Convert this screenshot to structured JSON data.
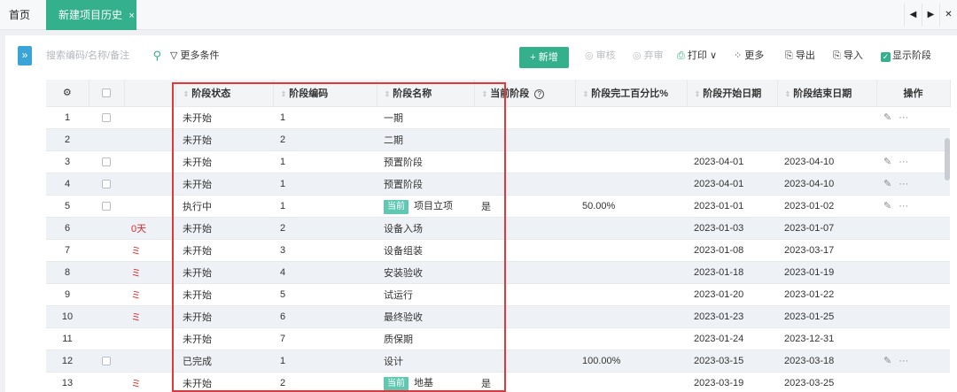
{
  "tabs": {
    "home": "首页",
    "active": "新建项目历史",
    "close": "×"
  },
  "nav": {
    "prev": "◀",
    "next": "▶",
    "close": "✕"
  },
  "toolbar": {
    "search_placeholder": "搜索编码/名称/备注",
    "more_conditions": "更多条件",
    "new": "+ 新增",
    "review": "审核",
    "abandon": "弃审",
    "print": "打印",
    "more": "更多",
    "export": "导出",
    "import": "导入",
    "show_stage": "显示阶段"
  },
  "table": {
    "headers": {
      "status": "阶段状态",
      "code": "阶段编码",
      "name": "阶段名称",
      "current": "当前阶段",
      "percent": "阶段完工百分比%",
      "start": "阶段开始日期",
      "end": "阶段结束日期",
      "ops": "操作"
    },
    "current_tag": "当前",
    "rows": [
      {
        "idx": "1",
        "chk": true,
        "flag": "",
        "status": "未开始",
        "code": "1",
        "tag": false,
        "name": "一期",
        "current": "",
        "percent": "",
        "start": "",
        "end": "",
        "ops": true
      },
      {
        "idx": "2",
        "chk": false,
        "flag": "",
        "status": "未开始",
        "code": "2",
        "tag": false,
        "name": "二期",
        "current": "",
        "percent": "",
        "start": "",
        "end": "",
        "ops": false
      },
      {
        "idx": "3",
        "chk": true,
        "flag": "",
        "status": "未开始",
        "code": "1",
        "tag": false,
        "name": "预置阶段",
        "current": "",
        "percent": "",
        "start": "2023-04-01",
        "end": "2023-04-10",
        "ops": true
      },
      {
        "idx": "4",
        "chk": true,
        "flag": "",
        "status": "未开始",
        "code": "1",
        "tag": false,
        "name": "预置阶段",
        "current": "",
        "percent": "",
        "start": "2023-04-01",
        "end": "2023-04-10",
        "ops": true
      },
      {
        "idx": "5",
        "chk": true,
        "flag": "",
        "status": "执行中",
        "code": "1",
        "tag": true,
        "name": "项目立项",
        "current": "是",
        "percent": "50.00%",
        "start": "2023-01-01",
        "end": "2023-01-02",
        "ops": true
      },
      {
        "idx": "6",
        "chk": false,
        "flag": "0天",
        "status": "未开始",
        "code": "2",
        "tag": false,
        "name": "设备入场",
        "current": "",
        "percent": "",
        "start": "2023-01-03",
        "end": "2023-01-07",
        "ops": false
      },
      {
        "idx": "7",
        "chk": false,
        "flag": "ミ",
        "status": "未开始",
        "code": "3",
        "tag": false,
        "name": "设备组装",
        "current": "",
        "percent": "",
        "start": "2023-01-08",
        "end": "2023-03-17",
        "ops": false
      },
      {
        "idx": "8",
        "chk": false,
        "flag": "ミ",
        "status": "未开始",
        "code": "4",
        "tag": false,
        "name": "安装验收",
        "current": "",
        "percent": "",
        "start": "2023-01-18",
        "end": "2023-01-19",
        "ops": false
      },
      {
        "idx": "9",
        "chk": false,
        "flag": "ミ",
        "status": "未开始",
        "code": "5",
        "tag": false,
        "name": "试运行",
        "current": "",
        "percent": "",
        "start": "2023-01-20",
        "end": "2023-01-22",
        "ops": false
      },
      {
        "idx": "10",
        "chk": false,
        "flag": "ミ",
        "status": "未开始",
        "code": "6",
        "tag": false,
        "name": "最终验收",
        "current": "",
        "percent": "",
        "start": "2023-01-23",
        "end": "2023-01-25",
        "ops": false
      },
      {
        "idx": "11",
        "chk": false,
        "flag": "",
        "status": "未开始",
        "code": "7",
        "tag": false,
        "name": "质保期",
        "current": "",
        "percent": "",
        "start": "2023-01-24",
        "end": "2023-12-31",
        "ops": false
      },
      {
        "idx": "12",
        "chk": true,
        "flag": "",
        "status": "已完成",
        "code": "1",
        "tag": false,
        "name": "设计",
        "current": "",
        "percent": "100.00%",
        "start": "2023-03-15",
        "end": "2023-03-18",
        "ops": true
      },
      {
        "idx": "13",
        "chk": false,
        "flag": "ミ",
        "status": "未开始",
        "code": "2",
        "tag": true,
        "name": "地基",
        "current": "是",
        "percent": "",
        "start": "2023-03-19",
        "end": "2023-03-25",
        "ops": false
      }
    ]
  },
  "icons": {
    "collapse": "double-chevron-right-icon",
    "search": "search-icon",
    "filter": "filter-icon",
    "settings": "gear-icon",
    "edit": "edit-icon",
    "more": "ellipsis-icon",
    "help": "question-circle-icon"
  },
  "colors": {
    "accent": "#35b08d",
    "highlight": "#e0393b",
    "flag": "#e02a2a",
    "tag": "#5fc7b2"
  }
}
